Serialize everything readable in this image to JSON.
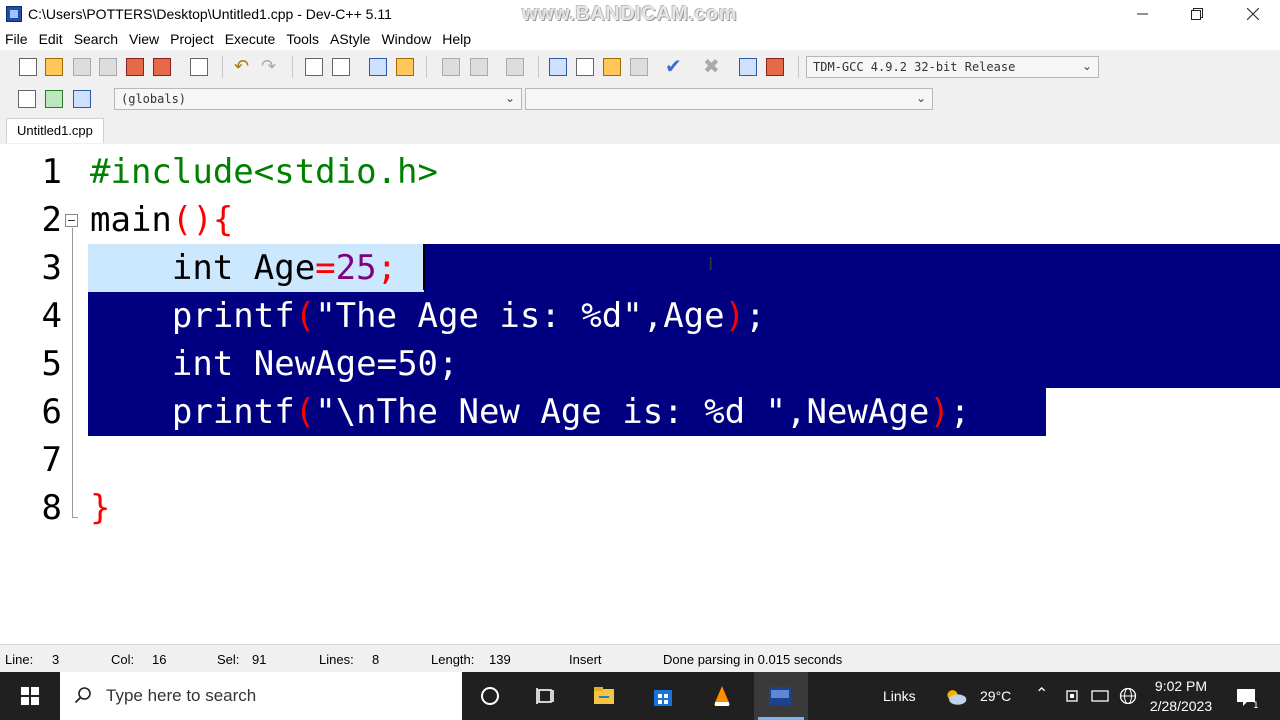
{
  "window": {
    "title": "C:\\Users\\POTTERS\\Desktop\\Untitled1.cpp - Dev-C++ 5.11",
    "watermark": "www.BANDICAM.com"
  },
  "menu": [
    "File",
    "Edit",
    "Search",
    "View",
    "Project",
    "Execute",
    "Tools",
    "AStyle",
    "Window",
    "Help"
  ],
  "toolbar": {
    "compiler_select": "TDM-GCC 4.9.2 32-bit Release",
    "scope_select": "(globals)",
    "function_select": ""
  },
  "tabs": [
    {
      "label": "Untitled1.cpp",
      "active": true
    }
  ],
  "editor": {
    "line_numbers": [
      "1",
      "2",
      "3",
      "4",
      "5",
      "6",
      "7",
      "8"
    ],
    "code": [
      "#include<stdio.h>",
      "main(){",
      "    int Age=25;",
      "    printf(\"The Age is: %d\",Age);",
      "    int NewAge=50;",
      "    printf(\"\\nThe New Age is: %d \",NewAge);",
      "",
      "}"
    ],
    "selection": {
      "from_line": 3,
      "to_line": 6
    },
    "colors": {
      "selection": "#000080",
      "current_line": "#cce8ff",
      "preprocessor": "#008000",
      "brace": "#ff0000",
      "number": "#800080",
      "string": "#0000ff"
    }
  },
  "status": {
    "line_label": "Line:",
    "line_value": "3",
    "col_label": "Col:",
    "col_value": "16",
    "sel_label": "Sel:",
    "sel_value": "91",
    "lines_label": "Lines:",
    "lines_value": "8",
    "length_label": "Length:",
    "length_value": "139",
    "mode": "Insert",
    "message": "Done parsing in 0.015 seconds"
  },
  "taskbar": {
    "search_placeholder": "Type here to search",
    "links": "Links",
    "weather": "29°C",
    "time": "9:02 PM",
    "date": "2/28/2023"
  }
}
